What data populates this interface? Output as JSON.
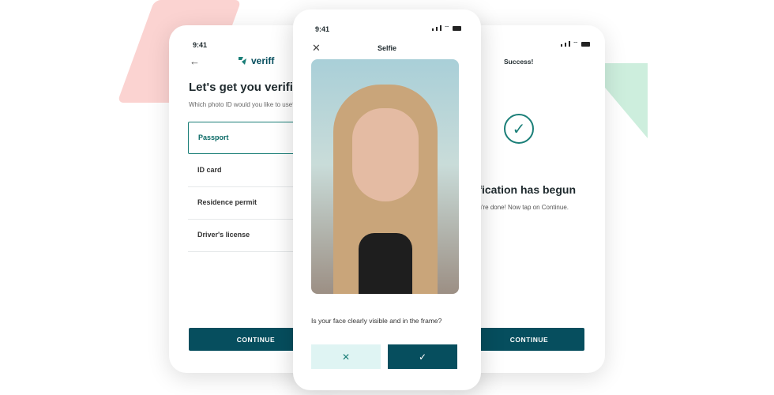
{
  "left_screen": {
    "time": "9:41",
    "brand": "veriff",
    "title": "Let's get you verified",
    "subtitle": "Which photo ID would you like to use?",
    "options": [
      "Passport",
      "ID card",
      "Residence permit",
      "Driver's license"
    ],
    "selected": "Passport",
    "continue_label": "CONTINUE"
  },
  "center_screen": {
    "time": "9:41",
    "title": "Selfie",
    "question": "Is your face clearly visible and in the frame?",
    "reject_icon": "x-icon",
    "accept_icon": "check-icon"
  },
  "right_screen": {
    "header": "Success!",
    "title": "Verification has begun",
    "subtitle": "You're done! Now tap on Continue.",
    "continue_label": "CONTINUE"
  },
  "colors": {
    "accent": "#064e5e",
    "teal": "#1b7f78",
    "reject_bg": "#dff4f3"
  }
}
